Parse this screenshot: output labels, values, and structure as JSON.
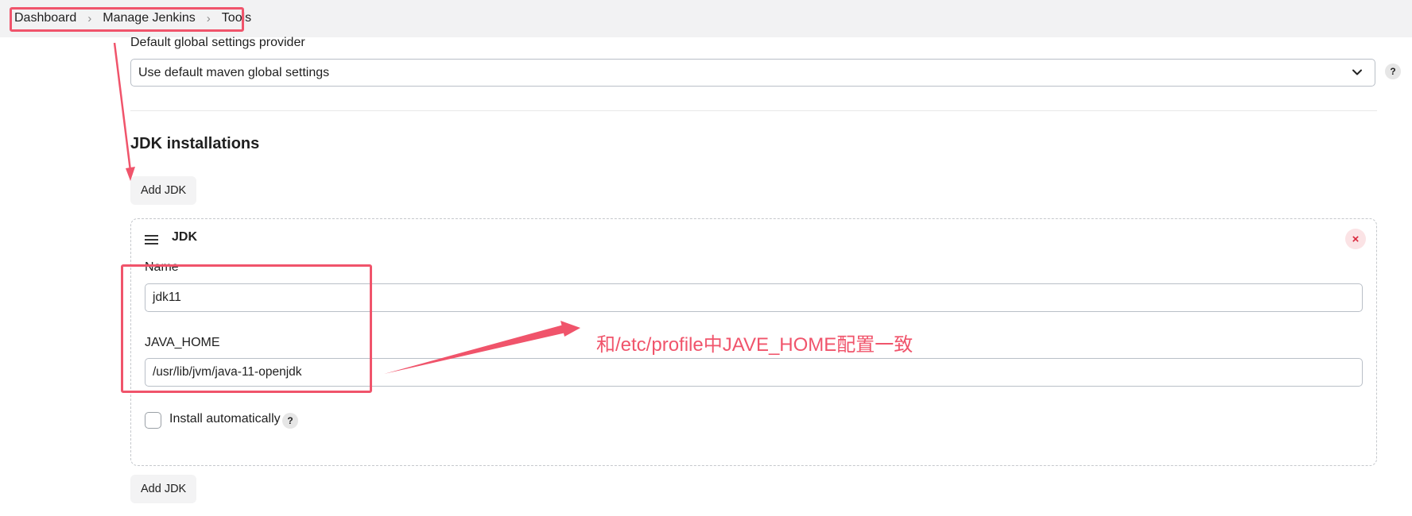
{
  "breadcrumb": {
    "items": [
      "Dashboard",
      "Manage Jenkins",
      "Tools"
    ]
  },
  "maven": {
    "global_settings_label": "Default global settings provider",
    "global_settings_value": "Use default maven global settings",
    "help": "?"
  },
  "jdk": {
    "section_title": "JDK installations",
    "add_button_label": "Add JDK",
    "item": {
      "title": "JDK",
      "close_glyph": "×",
      "name_label": "Name",
      "name_value": "jdk11",
      "java_home_label": "JAVA_HOME",
      "java_home_value": "/usr/lib/jvm/java-11-openjdk",
      "install_auto_label": "Install automatically",
      "install_auto_checked": false,
      "help": "?"
    }
  },
  "annotation": {
    "text": "和/etc/profile中JAVE_HOME配置一致",
    "color": "#f0546b"
  }
}
